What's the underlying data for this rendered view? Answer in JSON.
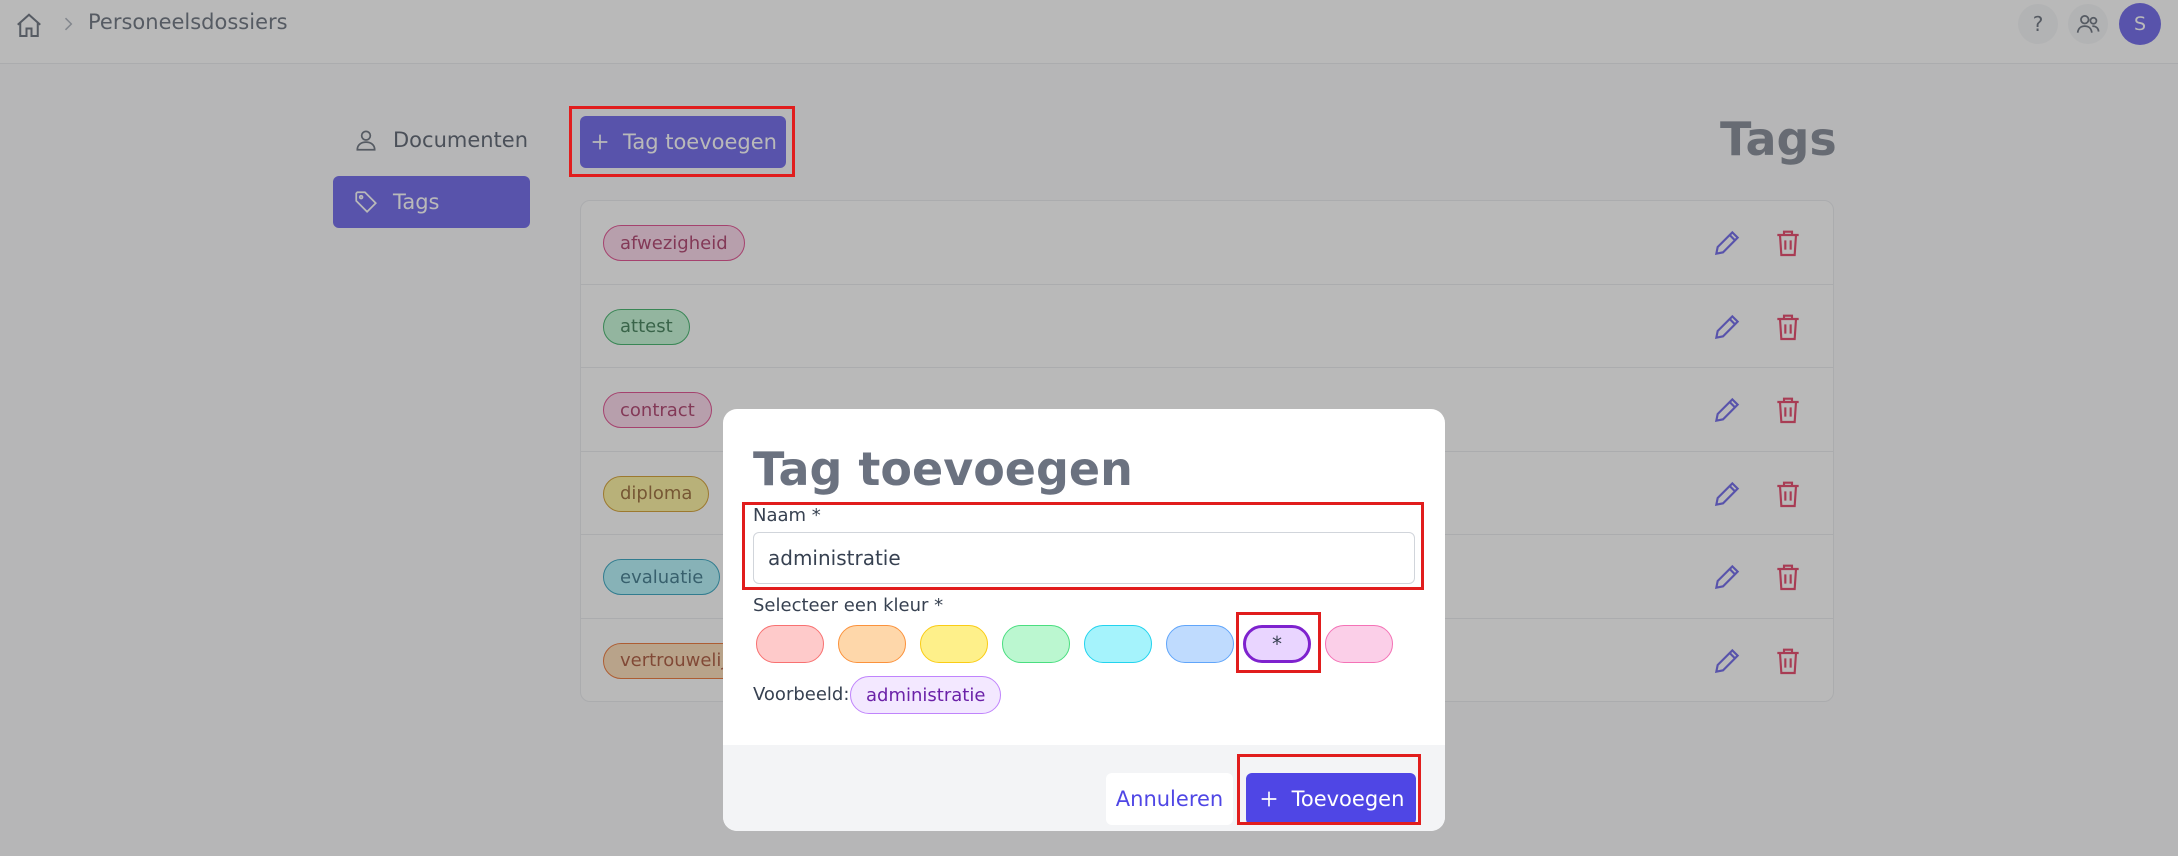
{
  "header": {
    "breadcrumb_title": "Personeelsdossiers",
    "help_label": "?",
    "avatar_initial": "S"
  },
  "sidebar": {
    "items": [
      {
        "label": "Documenten",
        "icon": "user-icon"
      },
      {
        "label": "Tags",
        "icon": "tag-icon",
        "active": true
      }
    ]
  },
  "main": {
    "add_button_label": "Tag toevoegen",
    "title": "Tags",
    "tags": [
      {
        "label": "afwezigheid",
        "bg": "#fbcfe8",
        "border": "#db2777",
        "text": "#9d174d"
      },
      {
        "label": "attest",
        "bg": "#bbf7d0",
        "border": "#16a34a",
        "text": "#166534"
      },
      {
        "label": "contract",
        "bg": "#fbcfe8",
        "border": "#db2777",
        "text": "#9d174d"
      },
      {
        "label": "diploma",
        "bg": "#fef08a",
        "border": "#ca8a04",
        "text": "#854d0e"
      },
      {
        "label": "evaluatie",
        "bg": "#a5f3fc",
        "border": "#0891b2",
        "text": "#155e75"
      },
      {
        "label": "vertrouwelijk",
        "bg": "#fed7aa",
        "border": "#ea580c",
        "text": "#9a3412"
      }
    ]
  },
  "modal": {
    "title": "Tag toevoegen",
    "name_label": "Naam *",
    "name_value": "administratie",
    "color_label": "Selecteer een kleur *",
    "colors": [
      {
        "name": "red",
        "bg": "#fecaca",
        "border": "#f87171"
      },
      {
        "name": "orange",
        "bg": "#fed7aa",
        "border": "#fb923c"
      },
      {
        "name": "yellow",
        "bg": "#fef08a",
        "border": "#facc15"
      },
      {
        "name": "green",
        "bg": "#bbf7d0",
        "border": "#4ade80"
      },
      {
        "name": "cyan",
        "bg": "#a5f3fc",
        "border": "#22d3ee"
      },
      {
        "name": "blue",
        "bg": "#bfdbfe",
        "border": "#60a5fa"
      },
      {
        "name": "purple",
        "bg": "#e9d5ff",
        "border": "#7e22ce",
        "selected": true,
        "mark": "*"
      },
      {
        "name": "pink",
        "bg": "#fbcfe8",
        "border": "#f472b6"
      }
    ],
    "preview_label": "Voorbeeld:",
    "preview_tag": "administratie",
    "cancel_label": "Annuleren",
    "submit_label": "Toevoegen"
  },
  "accent_color": "#4f46e5"
}
